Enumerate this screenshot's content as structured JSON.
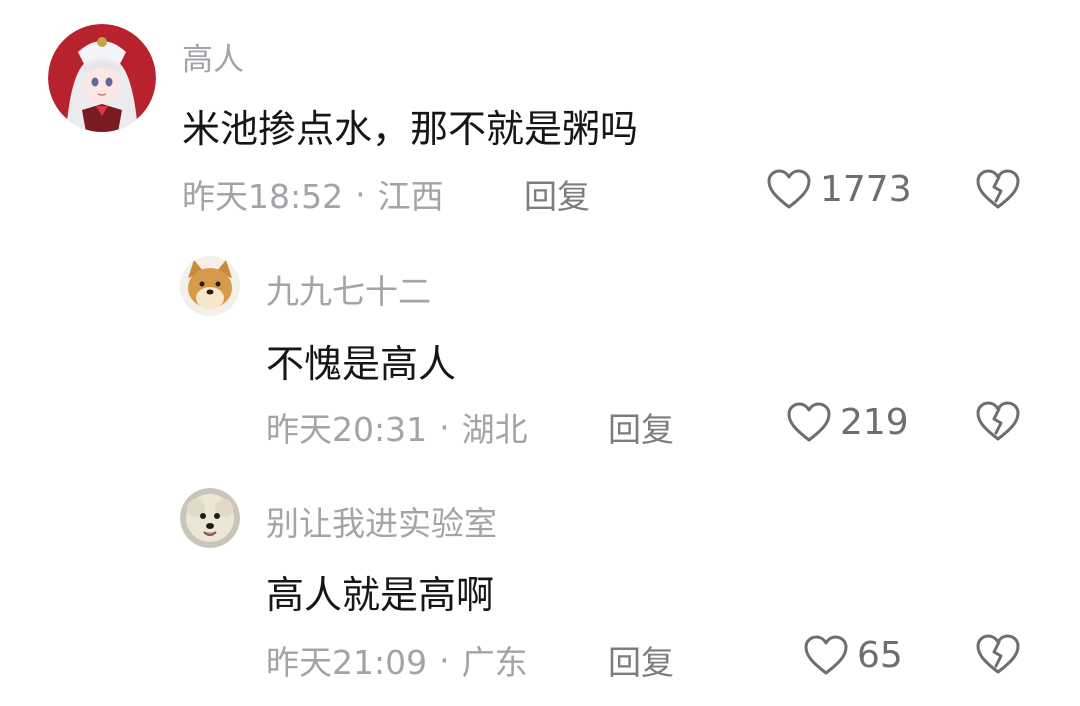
{
  "comments": [
    {
      "username": "高人",
      "content": "米池掺点水，那不就是粥吗",
      "time": "昨天18:52",
      "location": "江西",
      "reply_label": "回复",
      "likes": "1773",
      "avatar": "anime-girl-avatar"
    },
    {
      "username": "九九七十二",
      "content": "不愧是高人",
      "time": "昨天20:31",
      "location": "湖北",
      "reply_label": "回复",
      "likes": "219",
      "avatar": "shiba-doge-avatar"
    },
    {
      "username": "别让我进实验室",
      "content": "高人就是高啊",
      "time": "昨天21:09",
      "location": "广东",
      "reply_label": "回复",
      "likes": "65",
      "avatar": "poodle-dog-avatar"
    }
  ],
  "meta_separator": "·",
  "colors": {
    "text_primary": "#161616",
    "text_secondary": "#a3a3a8",
    "icon": "#6e6e72",
    "background": "#ffffff"
  },
  "icons": {
    "like": "heart-outline-icon",
    "dislike": "broken-heart-icon"
  }
}
